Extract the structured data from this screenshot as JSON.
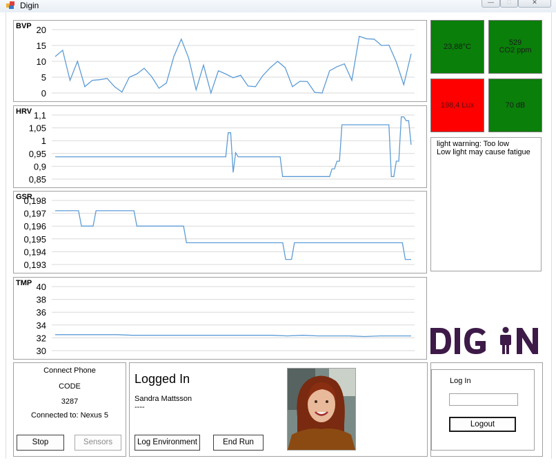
{
  "window": {
    "title": "Digin",
    "controls": {
      "minimize": "minimize-icon",
      "maximize": "maximize-icon",
      "close": "close-icon"
    }
  },
  "charts": [
    {
      "name": "BVP",
      "chart_data": {
        "type": "line",
        "title": "BVP",
        "ylim": [
          0,
          20
        ],
        "yticks": [
          0,
          5,
          10,
          15,
          20
        ],
        "ytick_labels": [
          "0",
          "5",
          "10",
          "15",
          "20"
        ],
        "grid": true,
        "color": "#5b9bd5",
        "values": [
          11.5,
          13.5,
          4,
          10,
          2,
          4,
          4.2,
          4.6,
          2,
          0.3,
          5,
          6,
          7.8,
          5.2,
          1.5,
          3.2,
          11.5,
          17,
          11,
          1,
          8.8,
          0,
          7,
          6,
          4.8,
          5.6,
          2.2,
          2,
          5.5,
          8,
          10,
          8,
          2,
          3.7,
          3.6,
          0.2,
          0,
          7,
          8.3,
          9.2,
          4,
          17.9,
          17.1,
          17,
          15,
          15.1,
          9.8,
          2.6,
          12.4
        ]
      }
    },
    {
      "name": "HRV",
      "chart_data": {
        "type": "line",
        "title": "HRV",
        "ylim": [
          0.85,
          1.1
        ],
        "yticks": [
          0.85,
          0.9,
          0.95,
          1,
          1.05,
          1.1
        ],
        "ytick_labels": [
          "0,85",
          "0,9",
          "0,95",
          "1",
          "1,05",
          "1,1"
        ],
        "grid": true,
        "color": "#5b9bd5",
        "values": [
          0.937,
          0.937,
          0.937,
          0.937,
          0.937,
          0.937,
          0.937,
          0.937,
          0.937,
          0.937,
          0.937,
          0.937,
          0.937,
          0.937,
          0.937,
          0.937,
          0.937,
          0.937,
          0.937,
          0.937,
          0.937,
          0.937,
          0.937,
          0.937,
          0.937,
          0.937,
          0.937,
          0.937,
          0.937,
          0.937,
          0.937,
          0.937,
          0.937,
          0.937,
          0.937,
          0.937,
          0.937,
          0.937,
          0.937,
          0.937,
          0.937,
          0.937,
          0.937,
          0.937,
          0.937,
          0.937,
          0.937,
          0.937,
          0.937,
          0.937,
          0.937,
          0.937,
          0.937,
          0.937,
          0.937,
          0.937,
          0.937,
          0.937,
          0.937,
          0.937,
          0.937,
          0.937,
          0.937,
          0.937,
          0.937,
          0.937,
          0.937,
          0.937,
          0.937,
          0.937,
          1.031,
          1.031,
          0.876,
          0.953,
          0.937,
          0.937,
          0.937,
          0.937,
          0.937,
          0.937,
          0.937,
          0.937,
          0.937,
          0.937,
          0.937,
          0.937,
          0.937,
          0.937,
          0.937,
          0.937,
          0.937,
          0.937,
          0.86,
          0.86,
          0.86,
          0.86,
          0.86,
          0.86,
          0.86,
          0.86,
          0.86,
          0.86,
          0.86,
          0.86,
          0.86,
          0.86,
          0.86,
          0.86,
          0.86,
          0.86,
          0.86,
          0.86,
          0.89,
          0.89,
          0.92,
          0.92,
          1.062,
          1.062,
          1.062,
          1.062,
          1.062,
          1.062,
          1.062,
          1.062,
          1.062,
          1.062,
          1.062,
          1.062,
          1.062,
          1.062,
          1.062,
          1.062,
          1.062,
          1.062,
          1.062,
          1.062,
          0.86,
          0.86,
          0.92,
          0.92,
          1.093,
          1.093,
          1.078,
          1.078,
          0.984
        ]
      }
    },
    {
      "name": "GSR",
      "chart_data": {
        "type": "line",
        "title": "GSR",
        "ylim": [
          0.193,
          0.198
        ],
        "yticks": [
          0.193,
          0.194,
          0.195,
          0.196,
          0.197,
          0.198
        ],
        "ytick_labels": [
          "0,193",
          "0,194",
          "0,195",
          "0,196",
          "0,197",
          "0,198"
        ],
        "grid": true,
        "color": "#5b9bd5",
        "values": [
          0.1972,
          0.1972,
          0.1972,
          0.1972,
          0.1972,
          0.1972,
          0.1972,
          0.1972,
          0.1972,
          0.196,
          0.196,
          0.196,
          0.196,
          0.196,
          0.1972,
          0.1972,
          0.1972,
          0.1972,
          0.1972,
          0.1972,
          0.1972,
          0.1972,
          0.1972,
          0.1972,
          0.1972,
          0.1972,
          0.1972,
          0.1972,
          0.196,
          0.196,
          0.196,
          0.196,
          0.196,
          0.196,
          0.196,
          0.196,
          0.196,
          0.196,
          0.196,
          0.196,
          0.196,
          0.196,
          0.196,
          0.196,
          0.196,
          0.1947,
          0.1947,
          0.1947,
          0.1947,
          0.1947,
          0.1947,
          0.1947,
          0.1947,
          0.1947,
          0.1947,
          0.1947,
          0.1947,
          0.1947,
          0.1947,
          0.1947,
          0.1947,
          0.1947,
          0.1947,
          0.1947,
          0.1947,
          0.1947,
          0.1947,
          0.1947,
          0.1947,
          0.1947,
          0.1947,
          0.1947,
          0.1947,
          0.1947,
          0.1947,
          0.1947,
          0.1947,
          0.1947,
          0.1947,
          0.1934,
          0.1934,
          0.1934,
          0.1947,
          0.1947,
          0.1947,
          0.1947,
          0.1947,
          0.1947,
          0.1947,
          0.1947,
          0.1947,
          0.1947,
          0.1947,
          0.1947,
          0.1947,
          0.1947,
          0.1947,
          0.1947,
          0.1947,
          0.1947,
          0.1947,
          0.1947,
          0.1947,
          0.1947,
          0.1947,
          0.1947,
          0.1947,
          0.1947,
          0.1947,
          0.1947,
          0.1947,
          0.1947,
          0.1947,
          0.1947,
          0.1947,
          0.1947,
          0.1947,
          0.1947,
          0.1947,
          0.1947,
          0.1934,
          0.1934,
          0.1934
        ]
      }
    },
    {
      "name": "TMP",
      "chart_data": {
        "type": "line",
        "title": "TMP",
        "ylim": [
          30,
          40
        ],
        "yticks": [
          30,
          32,
          34,
          36,
          38,
          40
        ],
        "ytick_labels": [
          "30",
          "32",
          "34",
          "36",
          "38",
          "40"
        ],
        "grid": true,
        "color": "#5b9bd5",
        "values": [
          32.5,
          32.5,
          32.5,
          32.5,
          32.5,
          32.4,
          32.4,
          32.4,
          32.4,
          32.4,
          32.4,
          32.4,
          32.4,
          32.4,
          32.4,
          32.3,
          32.4,
          32.3,
          32.3,
          32.3,
          32.2,
          32.3,
          32.3,
          32.3
        ]
      }
    }
  ],
  "env": {
    "temperature": {
      "value": "23,88°C",
      "color": "#0a7f0a"
    },
    "co2": {
      "value": "529",
      "unit": "CO2 ppm",
      "color": "#0a7f0a"
    },
    "light": {
      "value": "198,4 Lux",
      "color": "#ff0000"
    },
    "noise": {
      "value": "70 dB",
      "color": "#0a7f0a"
    }
  },
  "warning": {
    "line1": "light warning: Too low",
    "line2": "Low light may cause fatigue"
  },
  "logo": {
    "text": "DIG IN",
    "color": "#3d1a48"
  },
  "phone": {
    "title": "Connect Phone",
    "code_label": "CODE",
    "code": "3287",
    "connected": "Connected to: Nexus 5",
    "stop": "Stop",
    "sensors": "Sensors"
  },
  "session": {
    "status": "Logged In",
    "user": "Sandra Mattsson",
    "detail": "----",
    "log_env": "Log Environment",
    "end_run": "End Run"
  },
  "login": {
    "title": "Log In",
    "input_value": "",
    "logout": "Logout"
  }
}
